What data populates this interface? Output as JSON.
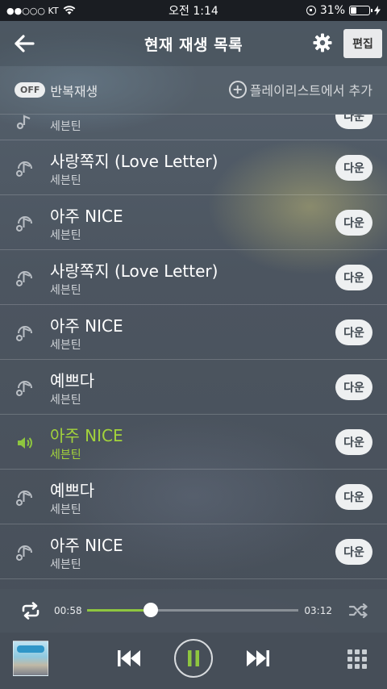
{
  "status_bar": {
    "carrier": "●●○○○ KT",
    "time": "오전 1:14",
    "battery_percent": "31%",
    "battery_level": 0.31
  },
  "header": {
    "title": "현재 재생 목록",
    "edit_label": "편집"
  },
  "controls": {
    "repeat_toggle_label": "OFF",
    "repeat_label": "반복재생",
    "add_playlist_label": "플레이리스트에서 추가"
  },
  "playlist": {
    "partial_top": {
      "artist": "세븐틴",
      "download_label": "다운"
    },
    "items": [
      {
        "title": "사랑쪽지 (Love Letter)",
        "artist": "세븐틴",
        "download_label": "다운"
      },
      {
        "title": "아주 NICE",
        "artist": "세븐틴",
        "download_label": "다운"
      },
      {
        "title": "사랑쪽지 (Love Letter)",
        "artist": "세븐틴",
        "download_label": "다운"
      },
      {
        "title": "아주 NICE",
        "artist": "세븐틴",
        "download_label": "다운"
      },
      {
        "title": "예쁘다",
        "artist": "세븐틴",
        "download_label": "다운"
      },
      {
        "title": "아주 NICE",
        "artist": "세븐틴",
        "download_label": "다운",
        "playing": true
      },
      {
        "title": "예쁘다",
        "artist": "세븐틴",
        "download_label": "다운"
      },
      {
        "title": "아주 NICE",
        "artist": "세븐틴",
        "download_label": "다운"
      }
    ]
  },
  "player": {
    "elapsed": "00:58",
    "duration": "03:12",
    "progress": 0.3,
    "accent_color": "#8ec63f",
    "icons": [
      "repeat-icon",
      "shuffle-icon",
      "previous-icon",
      "pause-icon",
      "next-icon",
      "grid-menu-icon"
    ]
  }
}
